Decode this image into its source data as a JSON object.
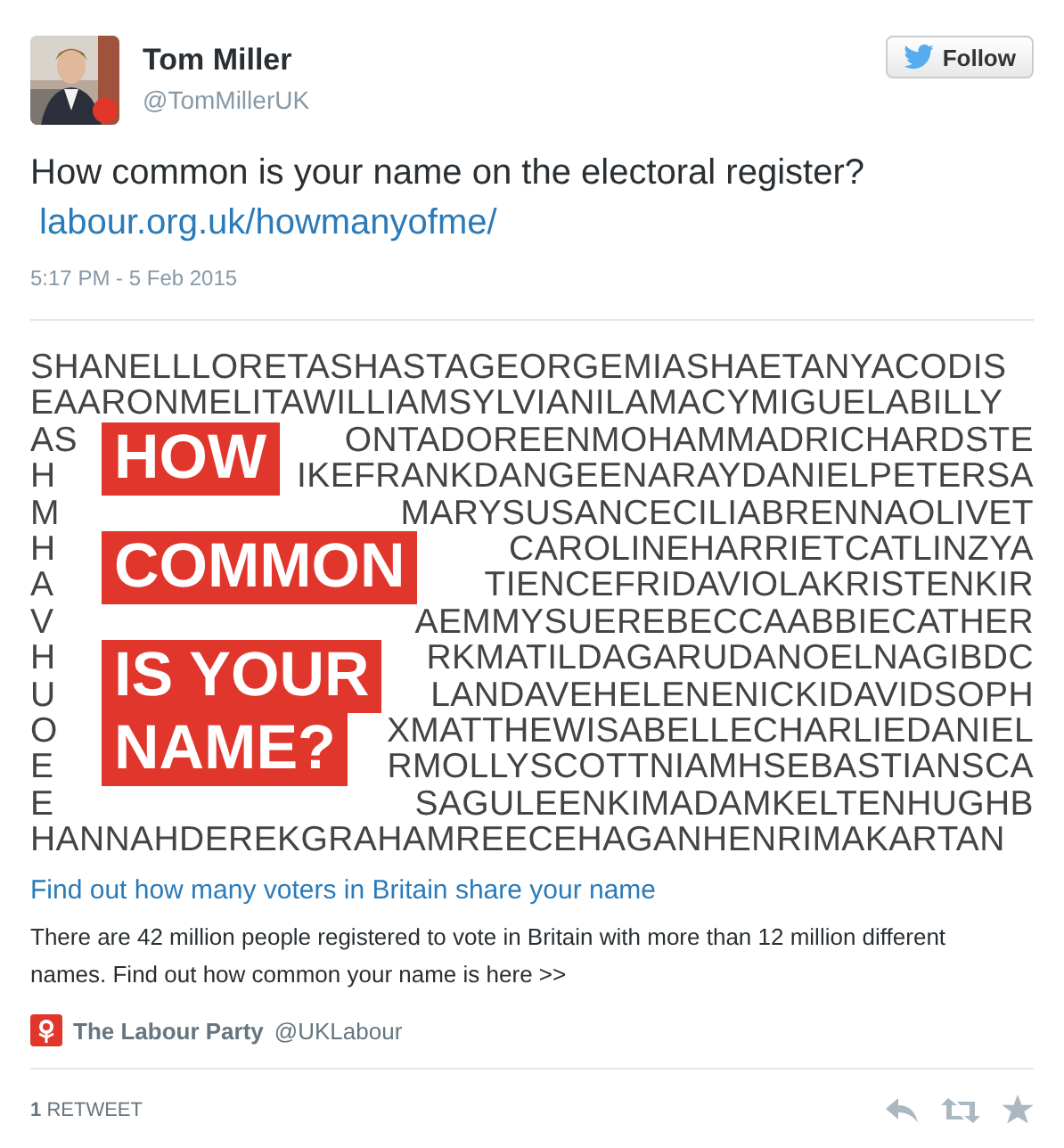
{
  "author": {
    "name": "Tom Miller",
    "handle": "@TomMillerUK"
  },
  "follow_button": {
    "label": "Follow"
  },
  "tweet": {
    "text": "How common is your name on the electoral register?",
    "link": "labour.org.uk/howmanyofme/",
    "timestamp": "5:17 PM - 5 Feb 2015"
  },
  "card": {
    "image": {
      "name_rows": [
        {
          "segments": [
            "SHANELLLORETASHASTAGEORGEMIASHAETANYACODIS"
          ]
        },
        {
          "segments": [
            "EAARONMELITAWILLIAMSYLVIANILAMACYMIGUELABILLY"
          ]
        },
        {
          "segments": [
            "AS",
            "ONTADOREENMOHAMMADRICHARDSTE"
          ]
        },
        {
          "segments": [
            "H",
            "IKEFRANKDANGEENARAYDANIELPETERSA"
          ]
        },
        {
          "segments": [
            "M",
            "MARYSUSANCECILIABRENNAOLIVET"
          ]
        },
        {
          "segments": [
            "H",
            "CAROLINEHARRIETCATLINZYA"
          ]
        },
        {
          "segments": [
            "A",
            "TIENCEFRIDAVIOLAKRISTENKIR"
          ]
        },
        {
          "segments": [
            "V",
            "AEMMYSUEREBECCAABBIECATHER"
          ]
        },
        {
          "segments": [
            "H",
            "RKMATILDAGARUDANOELNAGIBDC"
          ]
        },
        {
          "segments": [
            "U",
            "LANDAVEHELENENICKIDAVIDSOPH"
          ]
        },
        {
          "segments": [
            "O",
            "XMATTHEWISABELLECHARLIEDANIEL"
          ]
        },
        {
          "segments": [
            "E",
            "RMOLLYSCOTTNIAMHSEBASTIANSCA"
          ]
        },
        {
          "segments": [
            "E",
            "SAGULEENKIMADAMKELTENHUGHB"
          ]
        },
        {
          "segments": [
            "HANNAHDEREKGRAHAMREECEHAGANHENRIMAKARTAN"
          ]
        }
      ],
      "headline": [
        "HOW",
        "COMMON",
        "IS YOUR",
        "NAME?"
      ]
    },
    "title": "Find out how many voters in Britain share your name",
    "description": "There are 42 million people registered to vote in Britain with more than 12 million different names. Find out how common your name is here >>",
    "source": {
      "name": "The Labour Party",
      "handle": "@UKLabour"
    }
  },
  "stats": {
    "count": "1",
    "label": "RETWEET"
  }
}
